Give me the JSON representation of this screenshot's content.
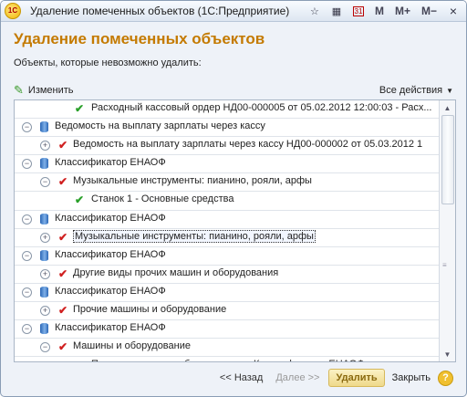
{
  "window": {
    "app_logo": "1С",
    "title": "Удаление помеченных объектов  (1С:Предприятие)",
    "toolbar_m": "M",
    "toolbar_mplus": "M+",
    "toolbar_mminus": "M−",
    "toolbar_calendar_day": "31"
  },
  "page": {
    "title": "Удаление помеченных объектов",
    "subtitle": "Объекты, которые невозможно удалить:"
  },
  "commands": {
    "edit_label": "Изменить",
    "all_actions_label": "Все действия"
  },
  "tree": {
    "rows": [
      {
        "level": 2,
        "text": "Расходный кассовый ордер НД00-000005 от 05.02.2012 12:00:03 - Расх...",
        "icon": "green-check-icon",
        "expander": "none"
      },
      {
        "level": 0,
        "text": "Ведомость на выплату зарплаты через кассу",
        "icon": "database-icon",
        "expander": "minus"
      },
      {
        "level": 1,
        "text": "Ведомость на выплату зарплаты через кассу НД00-000002 от 05.03.2012 1",
        "icon": "red-check-icon",
        "expander": "plus"
      },
      {
        "level": 0,
        "text": "Классификатор ЕНАОФ",
        "icon": "database-icon",
        "expander": "minus"
      },
      {
        "level": 1,
        "text": "Музыкальные инструменты: пианино, рояли, арфы",
        "icon": "red-check-icon",
        "expander": "minus"
      },
      {
        "level": 2,
        "text": "Станок 1 - Основные средства",
        "icon": "green-check-icon",
        "expander": "none"
      },
      {
        "level": 0,
        "text": "Классификатор ЕНАОФ",
        "icon": "database-icon",
        "expander": "minus"
      },
      {
        "level": 1,
        "text": "Музыкальные инструменты: пианино, рояли, арфы",
        "icon": "red-check-icon",
        "expander": "plus",
        "selected": true
      },
      {
        "level": 0,
        "text": "Классификатор ЕНАОФ",
        "icon": "database-icon",
        "expander": "minus"
      },
      {
        "level": 1,
        "text": "Другие виды прочих машин и оборудования",
        "icon": "red-check-icon",
        "expander": "plus"
      },
      {
        "level": 0,
        "text": "Классификатор ЕНАОФ",
        "icon": "database-icon",
        "expander": "minus"
      },
      {
        "level": 1,
        "text": "Прочие машины и оборудование",
        "icon": "red-check-icon",
        "expander": "plus"
      },
      {
        "level": 0,
        "text": "Классификатор ЕНАОФ",
        "icon": "database-icon",
        "expander": "minus"
      },
      {
        "level": 1,
        "text": "Машины и оборудование",
        "icon": "red-check-icon",
        "expander": "minus"
      },
      {
        "level": 2,
        "text": "Прочие машины и оборудование - Классификатор ЕНАОФ",
        "icon": "green-check-icon",
        "expander": "none"
      }
    ]
  },
  "footer": {
    "back_label": "<< Назад",
    "next_label": "Далее >>",
    "delete_label": "Удалить",
    "close_label": "Закрыть",
    "help_label": "?"
  },
  "colors": {
    "title_accent": "#c47a00",
    "green_check": "#2aa02a",
    "red_check": "#d02020"
  }
}
